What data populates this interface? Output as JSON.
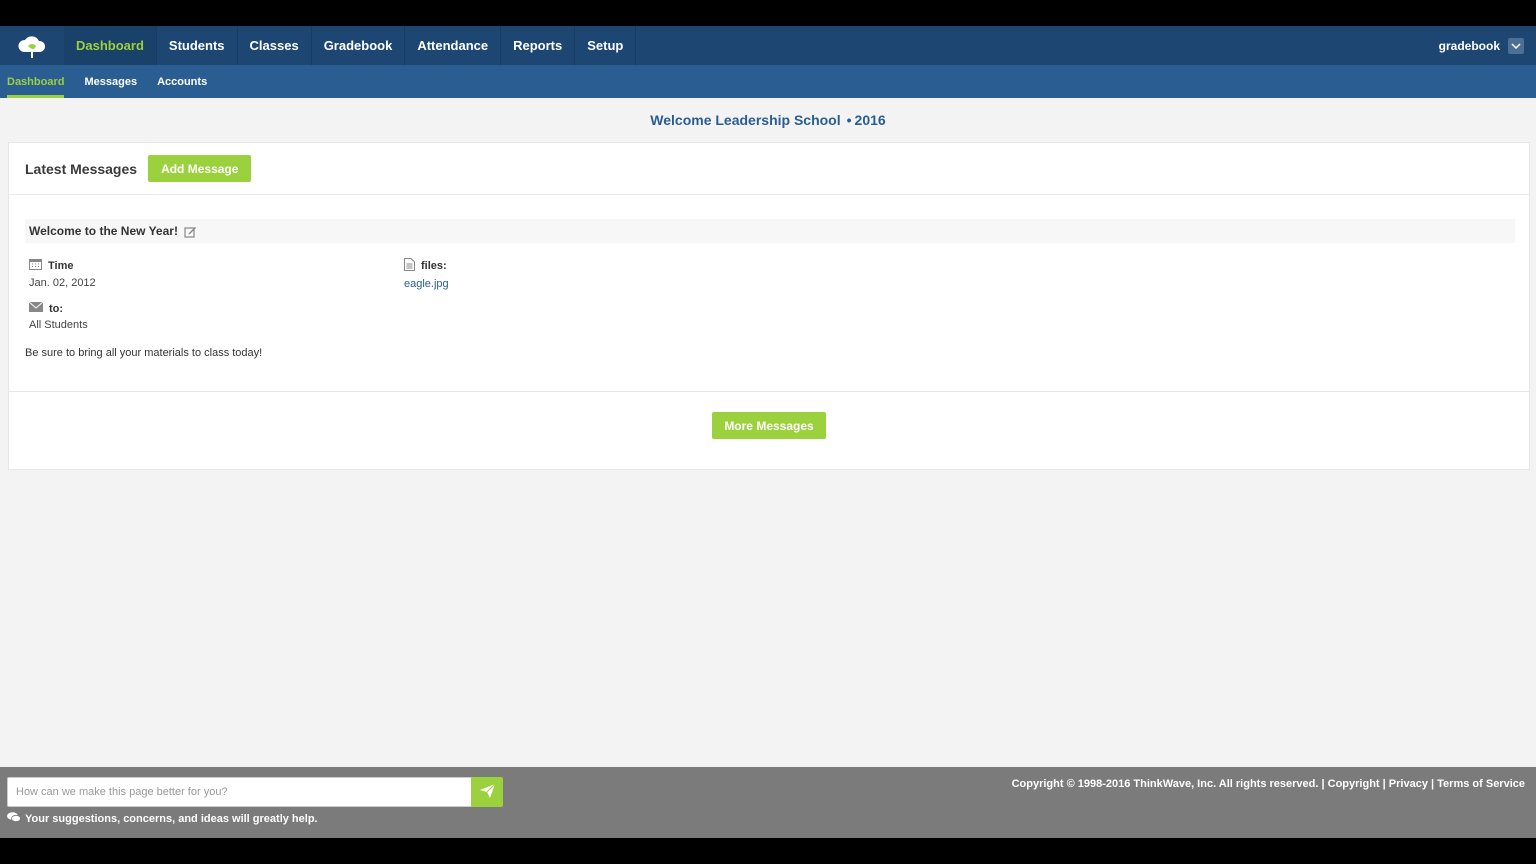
{
  "nav": {
    "items": [
      {
        "label": "Dashboard",
        "active": true
      },
      {
        "label": "Students"
      },
      {
        "label": "Classes"
      },
      {
        "label": "Gradebook"
      },
      {
        "label": "Attendance"
      },
      {
        "label": "Reports"
      },
      {
        "label": "Setup"
      }
    ],
    "user": "gradebook"
  },
  "subnav": {
    "items": [
      {
        "label": "Dashboard",
        "active": true
      },
      {
        "label": "Messages"
      },
      {
        "label": "Accounts"
      }
    ]
  },
  "welcome": {
    "text": "Welcome Leadership School",
    "bullet": "•",
    "year": "2016"
  },
  "messages": {
    "heading": "Latest Messages",
    "add_label": "Add Message",
    "item": {
      "title": "Welcome to the New Year!",
      "time_label": "Time",
      "time_value": "Jan. 02, 2012",
      "files_label": "files:",
      "files_value": "eagle.jpg",
      "to_label": "to:",
      "to_value": "All Students",
      "body": "Be sure to bring all your materials to class today!"
    },
    "more_label": "More Messages"
  },
  "footer": {
    "feedback_placeholder": "How can we make this page better for you?",
    "feedback_note": "Your suggestions, concerns, and ideas will greatly help.",
    "copyright": "Copyright © 1998-2016 ThinkWave, Inc. All rights reserved.",
    "sep": "|",
    "links": [
      "Copyright",
      "Privacy",
      "Terms of Service"
    ]
  },
  "colors": {
    "nav_bg": "#1d4772",
    "subnav_bg": "#2a5d91",
    "accent_green": "#9bd13c",
    "footer_bg": "#7b7b7b"
  },
  "icons": [
    "cloud-logo-icon",
    "chevron-down-icon",
    "edit-icon",
    "calendar-icon",
    "file-icon",
    "envelope-icon",
    "send-icon",
    "chat-icon"
  ]
}
